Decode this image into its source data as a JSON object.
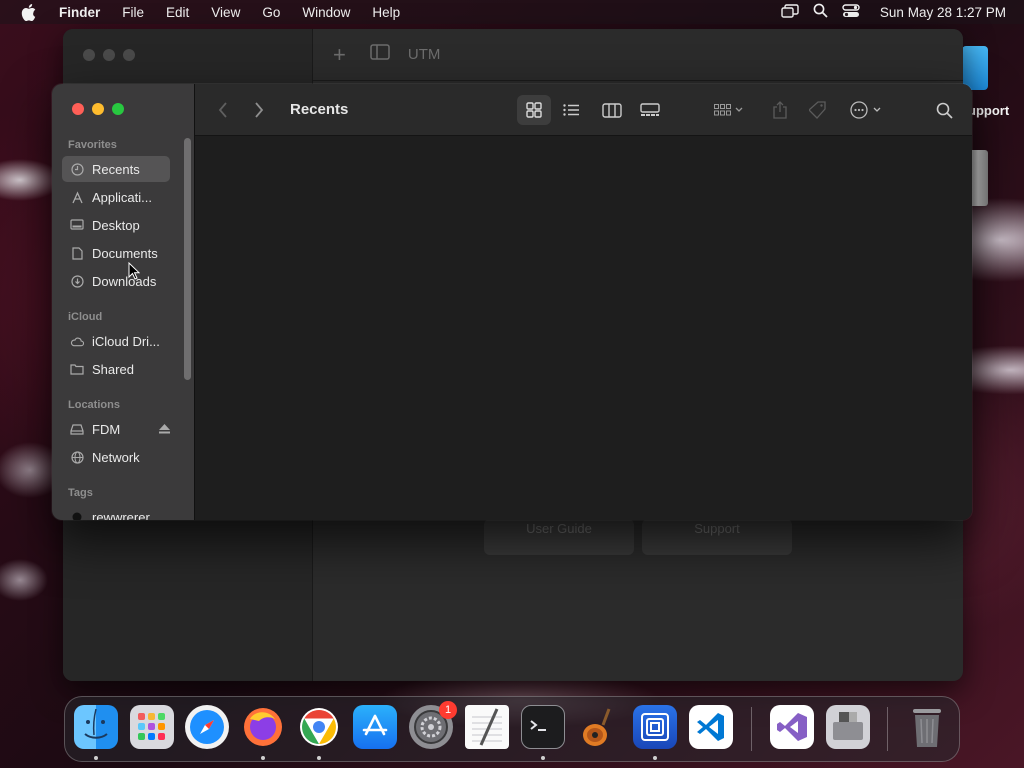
{
  "menubar": {
    "app_name": "Finder",
    "items": [
      "File",
      "Edit",
      "View",
      "Go",
      "Window",
      "Help"
    ],
    "clock": "Sun May 28  1:27 PM"
  },
  "utm": {
    "title": "UTM",
    "guide_label": "User Guide",
    "support_label": "Support"
  },
  "desktop": {
    "support_label": "upport"
  },
  "finder": {
    "title": "Recents",
    "sidebar": {
      "favorites_header": "Favorites",
      "favorites": [
        "Recents",
        "Applicati...",
        "Desktop",
        "Documents",
        "Downloads"
      ],
      "icloud_header": "iCloud",
      "icloud": [
        "iCloud Dri...",
        "Shared"
      ],
      "locations_header": "Locations",
      "locations": [
        "FDM",
        "Network"
      ],
      "tags_header": "Tags",
      "tags": [
        "rewwrerer"
      ]
    }
  },
  "dock": {
    "apps": [
      "Finder",
      "Launchpad",
      "Safari",
      "Firefox",
      "Chrome",
      "App Store",
      "System Preferences",
      "TextEdit",
      "Terminal",
      "GarageBand",
      "UTM",
      "Visual Studio Code",
      "Visual Studio",
      "Boot Camp Assistant",
      "Trash"
    ],
    "settings_badge": "1"
  },
  "colors": {
    "close": "#ff5f57",
    "minimize": "#febc2e",
    "zoom": "#28c840",
    "selected_row": "#555455"
  }
}
